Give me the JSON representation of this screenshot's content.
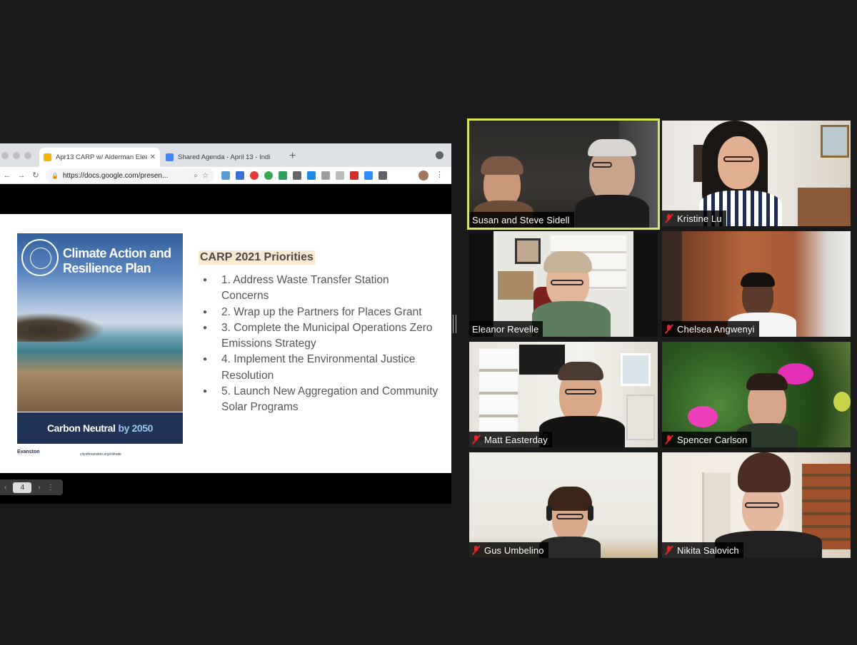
{
  "browser": {
    "tabs": [
      {
        "label": "Apr13 CARP w/ Alderman Elea",
        "active": true
      },
      {
        "label": "Shared Agenda - April 13 - Indi",
        "active": false
      }
    ],
    "url": "https://docs.google.com/presen..."
  },
  "slide": {
    "cover_title": "Climate Action and Resilience Plan",
    "band_main": "Carbon Neutral",
    "band_accent": "by 2050",
    "footer_logo": "Evanston",
    "footer_web": "cityofevanston.org/climate",
    "priorities_title": "CARP 2021 Priorities",
    "priorities": [
      "1. Address Waste Transfer Station Concerns",
      "2. Wrap up the Partners for Places Grant",
      "3. Complete the Municipal Operations Zero Emissions Strategy",
      "4. Implement the Environmental Justice Resolution",
      "5. Launch New Aggregation and Community Solar Programs"
    ]
  },
  "pager": {
    "page": "4"
  },
  "participants": [
    {
      "name": "Susan and Steve Sidell",
      "muted": false,
      "speaking": true
    },
    {
      "name": "Kristine Lu",
      "muted": true,
      "speaking": false
    },
    {
      "name": "Eleanor Revelle",
      "muted": false,
      "speaking": false
    },
    {
      "name": "Chelsea Angwenyi",
      "muted": true,
      "speaking": false
    },
    {
      "name": "Matt Easterday",
      "muted": true,
      "speaking": false
    },
    {
      "name": "Spencer Carlson",
      "muted": true,
      "speaking": false
    },
    {
      "name": "Gus Umbelino",
      "muted": true,
      "speaking": false
    },
    {
      "name": "Nikita Salovich",
      "muted": true,
      "speaking": false
    }
  ],
  "colors": {
    "active_speaker_border": "#d8e65b",
    "mute_icon": "#e02828",
    "cover_band": "#1f3354",
    "priorities_highlight": "#fbe9cf"
  }
}
